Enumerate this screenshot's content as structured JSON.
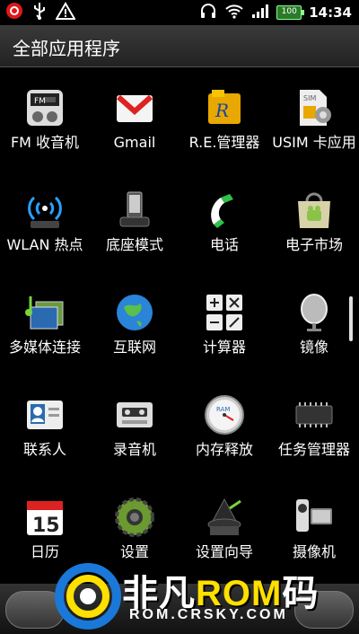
{
  "status_bar": {
    "time": "14:34",
    "battery": "100",
    "left_icons": [
      "record-icon",
      "usb-icon",
      "warning-icon"
    ],
    "right_icons": [
      "headset-icon",
      "wifi-icon",
      "signal-icon",
      "battery-icon"
    ]
  },
  "header": {
    "title": "全部应用程序"
  },
  "apps": [
    {
      "label": "FM 收音机",
      "icon": "fm-radio-icon"
    },
    {
      "label": "Gmail",
      "icon": "gmail-icon"
    },
    {
      "label": "R.E.管理器",
      "icon": "re-manager-icon"
    },
    {
      "label": "USIM 卡应用",
      "icon": "usim-icon"
    },
    {
      "label": "WLAN 热点",
      "icon": "wlan-hotspot-icon"
    },
    {
      "label": "底座模式",
      "icon": "dock-mode-icon"
    },
    {
      "label": "电话",
      "icon": "phone-icon"
    },
    {
      "label": "电子市场",
      "icon": "market-icon"
    },
    {
      "label": "多媒体连接",
      "icon": "media-connect-icon"
    },
    {
      "label": "互联网",
      "icon": "internet-icon"
    },
    {
      "label": "计算器",
      "icon": "calculator-icon"
    },
    {
      "label": "镜像",
      "icon": "mirror-icon"
    },
    {
      "label": "联系人",
      "icon": "contacts-icon"
    },
    {
      "label": "录音机",
      "icon": "recorder-icon"
    },
    {
      "label": "内存释放",
      "icon": "memory-release-icon"
    },
    {
      "label": "任务管理器",
      "icon": "task-manager-icon"
    },
    {
      "label": "日历",
      "icon": "calendar-icon"
    },
    {
      "label": "设置",
      "icon": "settings-icon"
    },
    {
      "label": "设置向导",
      "icon": "setup-wizard-icon"
    },
    {
      "label": "摄像机",
      "icon": "camcorder-icon"
    }
  ],
  "calendar_day": "15",
  "watermark": {
    "brand_prefix": "非凡",
    "brand_rom": "ROM",
    "brand_suffix": "码",
    "url": "ROM.CRSKY.COM"
  }
}
